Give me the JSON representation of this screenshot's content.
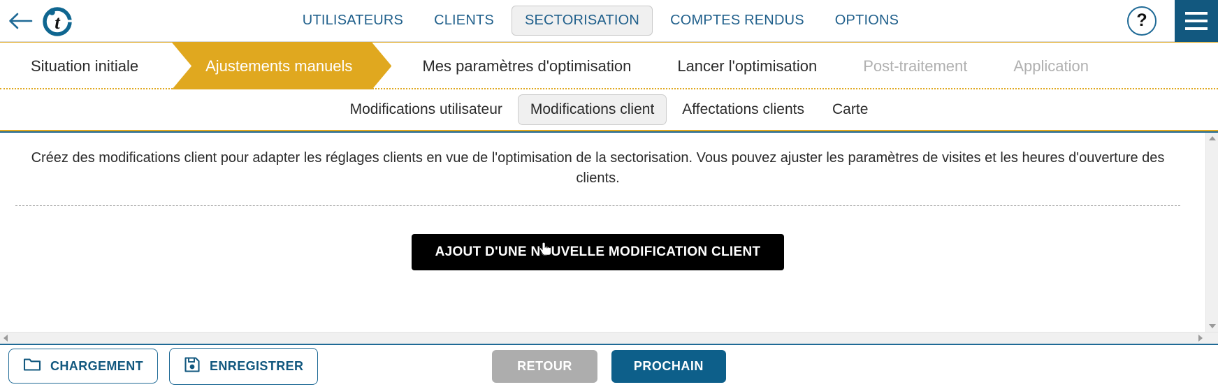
{
  "header": {
    "back_icon": "arrow-left-icon",
    "logo_letter": "t",
    "nav": [
      {
        "label": "UTILISATEURS",
        "active": false
      },
      {
        "label": "CLIENTS",
        "active": false
      },
      {
        "label": "SECTORISATION",
        "active": true
      },
      {
        "label": "COMPTES RENDUS",
        "active": false
      },
      {
        "label": "OPTIONS",
        "active": false
      }
    ],
    "help_label": "?",
    "help_icon": "question-mark-icon",
    "menu_icon": "hamburger-menu-icon"
  },
  "steps": [
    {
      "label": "Situation initiale",
      "state": "normal"
    },
    {
      "label": "Ajustements manuels",
      "state": "active"
    },
    {
      "label": "Mes paramètres d'optimisation",
      "state": "normal"
    },
    {
      "label": "Lancer l'optimisation",
      "state": "normal"
    },
    {
      "label": "Post-traitement",
      "state": "disabled"
    },
    {
      "label": "Application",
      "state": "disabled"
    }
  ],
  "subtabs": [
    {
      "label": "Modifications utilisateur",
      "active": false
    },
    {
      "label": "Modifications client",
      "active": true
    },
    {
      "label": "Affectations clients",
      "active": false
    },
    {
      "label": "Carte",
      "active": false
    }
  ],
  "content": {
    "description": "Créez des modifications client pour adapter les réglages clients en vue de l'optimisation de la sectorisation. Vous pouvez ajuster les paramètres de visites et les heures d'ouverture des clients.",
    "add_button_label": "AJOUT D'UNE NOUVELLE MODIFICATION CLIENT"
  },
  "footer": {
    "load_label": "CHARGEMENT",
    "load_icon": "folder-icon",
    "save_label": "ENREGISTRER",
    "save_icon": "floppy-disk-icon",
    "back_label": "RETOUR",
    "next_label": "PROCHAIN"
  },
  "colors": {
    "accent_blue": "#12587f",
    "nav_blue": "#1f5f8b",
    "gold": "#e0a81f",
    "disabled_gray": "#adadad",
    "black_button": "#000000"
  }
}
